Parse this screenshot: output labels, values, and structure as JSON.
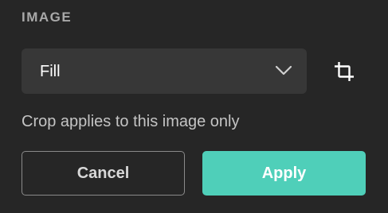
{
  "section": {
    "title": "IMAGE"
  },
  "fit_select": {
    "value": "Fill",
    "icon": "chevron-down-icon"
  },
  "crop_button": {
    "icon": "crop-icon"
  },
  "hint": "Crop applies to this image only",
  "actions": {
    "cancel_label": "Cancel",
    "apply_label": "Apply"
  },
  "colors": {
    "background": "#262626",
    "select_background": "#373737",
    "accent": "#4fcfb9"
  }
}
